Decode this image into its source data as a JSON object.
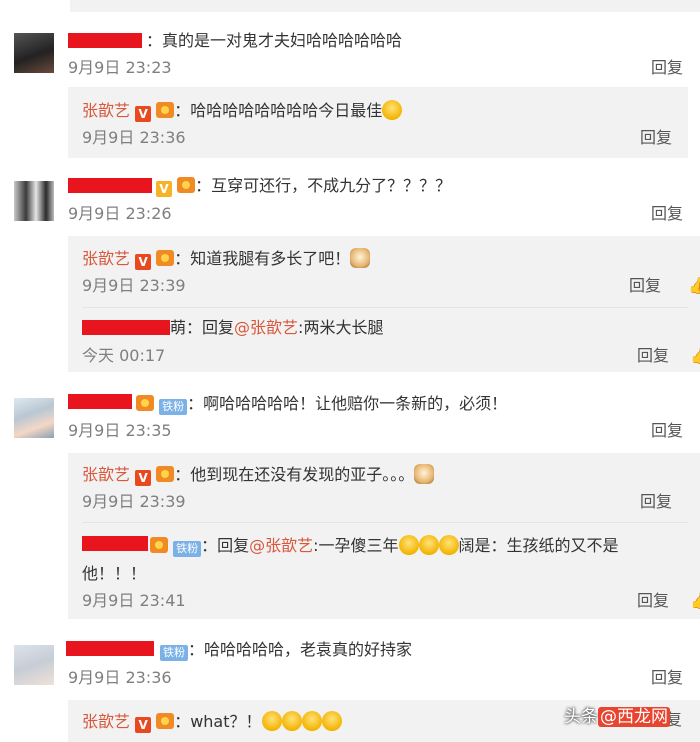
{
  "comments": [
    {
      "text": "：真的是一对鬼才夫妇哈哈哈哈哈哈",
      "time": "9月9日 23:23",
      "reply_label": "回复",
      "replies": [
        {
          "name": "张歆艺",
          "text": "：哈哈哈哈哈哈哈哈今日最佳",
          "emoji": "laugh-cry-emoji",
          "time": "9月9日 23:36",
          "reply_label": "回复"
        }
      ]
    },
    {
      "text": "：互穿可还行，不成九分了？？？？",
      "time": "9月9日 23:26",
      "reply_label": "回复",
      "replies": [
        {
          "name": "张歆艺",
          "text": "：知道我腿有多长了吧！",
          "emoji": "cat-emoji",
          "time": "9月9日 23:39",
          "reply_label": "回复"
        },
        {
          "name_tail": "萌",
          "reply_prefix": "：回复",
          "mention": "@张歆艺",
          "text": ":两米大长腿",
          "time": "今天 00:17",
          "reply_label": "回复"
        }
      ]
    },
    {
      "badge": "铁粉",
      "text": "：啊哈哈哈哈哈！让他赔你一条新的，必须！",
      "time": "9月9日 23:35",
      "reply_label": "回复",
      "replies": [
        {
          "name": "张歆艺",
          "text": "：他到现在还没有发现的亚子。。。",
          "emoji": "cat-emoji",
          "time": "9月9日 23:39",
          "reply_label": "回复"
        },
        {
          "badge": "铁粉",
          "reply_prefix": "：回复",
          "mention": "@张歆艺",
          "text_a": ":一孕傻三年",
          "text_b": "阔是：生孩纸的又不是",
          "text_c": "他！！！",
          "time": "9月9日 23:41",
          "reply_label": "回复"
        }
      ]
    },
    {
      "badge": "铁粉",
      "text": "：哈哈哈哈哈，老袁真的好持家",
      "time": "9月9日 23:36",
      "reply_label": "回复",
      "replies": [
        {
          "name": "张歆艺",
          "text": "：what？！",
          "reply_label_partial": "复"
        }
      ]
    }
  ],
  "vip_badge": "V",
  "watermark": {
    "prefix": "头条",
    "brand": "@西龙网"
  },
  "colors": {
    "name": "#d9573b",
    "redaction": "#e8141e",
    "reply_bg": "#f2f2f2",
    "meta": "#7f7f7f"
  }
}
